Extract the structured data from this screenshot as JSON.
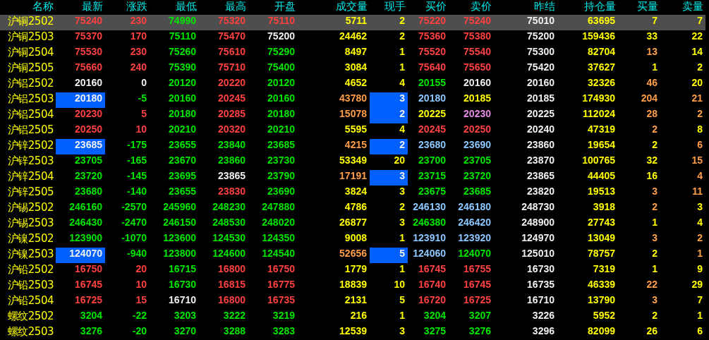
{
  "columns": [
    "名称",
    "最新",
    "涨跌",
    "最低",
    "最高",
    "开盘",
    "成交量",
    "现手",
    "买价",
    "卖价",
    "昨结",
    "持仓量",
    "买量",
    "卖量"
  ],
  "rows": [
    {
      "name": "沪铜2502",
      "selected": true,
      "cells": [
        {
          "text": "75240",
          "color": "#ff4040",
          "flash": false
        },
        {
          "text": "230",
          "color": "#ff4040",
          "flash": false
        },
        {
          "text": "74990",
          "color": "#00e600",
          "flash": false
        },
        {
          "text": "75320",
          "color": "#ff4040",
          "flash": false
        },
        {
          "text": "75110",
          "color": "#ff4040",
          "flash": false
        },
        {
          "text": "5711",
          "color": "#ffff00",
          "flash": false
        },
        {
          "text": "2",
          "color": "#ffff00",
          "flash": false
        },
        {
          "text": "75220",
          "color": "#ff4040",
          "flash": false
        },
        {
          "text": "75240",
          "color": "#ff4040",
          "flash": false
        },
        {
          "text": "75010",
          "color": "#f0f0f0",
          "flash": false
        },
        {
          "text": "63695",
          "color": "#ffff00",
          "flash": false
        },
        {
          "text": "7",
          "color": "#ffff00",
          "flash": false
        },
        {
          "text": "7",
          "color": "#ffff00",
          "flash": false
        }
      ]
    },
    {
      "name": "沪铜2503",
      "selected": false,
      "cells": [
        {
          "text": "75370",
          "color": "#ff4040",
          "flash": false
        },
        {
          "text": "170",
          "color": "#ff4040",
          "flash": false
        },
        {
          "text": "75110",
          "color": "#00e600",
          "flash": false
        },
        {
          "text": "75470",
          "color": "#ff4040",
          "flash": false
        },
        {
          "text": "75200",
          "color": "#f0f0f0",
          "flash": false
        },
        {
          "text": "24462",
          "color": "#ffff00",
          "flash": false
        },
        {
          "text": "2",
          "color": "#ffff00",
          "flash": false
        },
        {
          "text": "75360",
          "color": "#ff4040",
          "flash": false
        },
        {
          "text": "75380",
          "color": "#ff4040",
          "flash": false
        },
        {
          "text": "75200",
          "color": "#f0f0f0",
          "flash": false
        },
        {
          "text": "159436",
          "color": "#ffff00",
          "flash": false
        },
        {
          "text": "33",
          "color": "#ffff00",
          "flash": false
        },
        {
          "text": "22",
          "color": "#ffff00",
          "flash": false
        }
      ]
    },
    {
      "name": "沪铜2504",
      "selected": false,
      "cells": [
        {
          "text": "75530",
          "color": "#ff4040",
          "flash": false
        },
        {
          "text": "230",
          "color": "#ff4040",
          "flash": false
        },
        {
          "text": "75260",
          "color": "#00e600",
          "flash": false
        },
        {
          "text": "75610",
          "color": "#ff4040",
          "flash": false
        },
        {
          "text": "75290",
          "color": "#00e600",
          "flash": false
        },
        {
          "text": "8497",
          "color": "#ffff00",
          "flash": false
        },
        {
          "text": "1",
          "color": "#ffff00",
          "flash": false
        },
        {
          "text": "75520",
          "color": "#ff4040",
          "flash": false
        },
        {
          "text": "75540",
          "color": "#ff4040",
          "flash": false
        },
        {
          "text": "75300",
          "color": "#f0f0f0",
          "flash": false
        },
        {
          "text": "82704",
          "color": "#ffff00",
          "flash": false
        },
        {
          "text": "13",
          "color": "#ff9e4a",
          "flash": false
        },
        {
          "text": "14",
          "color": "#ffff00",
          "flash": false
        }
      ]
    },
    {
      "name": "沪铜2505",
      "selected": false,
      "cells": [
        {
          "text": "75660",
          "color": "#ff4040",
          "flash": false
        },
        {
          "text": "240",
          "color": "#ff4040",
          "flash": false
        },
        {
          "text": "75390",
          "color": "#00e600",
          "flash": false
        },
        {
          "text": "75710",
          "color": "#ff4040",
          "flash": false
        },
        {
          "text": "75400",
          "color": "#00e600",
          "flash": false
        },
        {
          "text": "3084",
          "color": "#ffff00",
          "flash": false
        },
        {
          "text": "1",
          "color": "#ffff00",
          "flash": false
        },
        {
          "text": "75640",
          "color": "#ff4040",
          "flash": false
        },
        {
          "text": "75650",
          "color": "#ff4040",
          "flash": false
        },
        {
          "text": "75420",
          "color": "#f0f0f0",
          "flash": false
        },
        {
          "text": "37627",
          "color": "#ffff00",
          "flash": false
        },
        {
          "text": "1",
          "color": "#ffff00",
          "flash": false
        },
        {
          "text": "2",
          "color": "#ffff00",
          "flash": false
        }
      ]
    },
    {
      "name": "沪铝2502",
      "selected": false,
      "cells": [
        {
          "text": "20160",
          "color": "#f0f0f0",
          "flash": false
        },
        {
          "text": "0",
          "color": "#f0f0f0",
          "flash": false
        },
        {
          "text": "20120",
          "color": "#00e600",
          "flash": false
        },
        {
          "text": "20220",
          "color": "#ff4040",
          "flash": false
        },
        {
          "text": "20120",
          "color": "#00e600",
          "flash": false
        },
        {
          "text": "4652",
          "color": "#ffff00",
          "flash": false
        },
        {
          "text": "4",
          "color": "#ffff00",
          "flash": false
        },
        {
          "text": "20155",
          "color": "#00e600",
          "flash": false
        },
        {
          "text": "20160",
          "color": "#f0f0f0",
          "flash": false
        },
        {
          "text": "20160",
          "color": "#f0f0f0",
          "flash": false
        },
        {
          "text": "32326",
          "color": "#ffff00",
          "flash": false
        },
        {
          "text": "46",
          "color": "#ff9e4a",
          "flash": false
        },
        {
          "text": "20",
          "color": "#ffff00",
          "flash": false
        }
      ]
    },
    {
      "name": "沪铝2503",
      "selected": false,
      "cells": [
        {
          "text": "20180",
          "color": "#f0f0f0",
          "flash": true
        },
        {
          "text": "-5",
          "color": "#00e600",
          "flash": false
        },
        {
          "text": "20160",
          "color": "#00e600",
          "flash": false
        },
        {
          "text": "20245",
          "color": "#ff4040",
          "flash": false
        },
        {
          "text": "20160",
          "color": "#00e600",
          "flash": false
        },
        {
          "text": "43780",
          "color": "#ff9e4a",
          "flash": false
        },
        {
          "text": "3",
          "color": "#f0f0f0",
          "flash": true
        },
        {
          "text": "20180",
          "color": "#8cc8ff",
          "flash": false
        },
        {
          "text": "20185",
          "color": "#ffff00",
          "flash": false
        },
        {
          "text": "20185",
          "color": "#f0f0f0",
          "flash": false
        },
        {
          "text": "174930",
          "color": "#ffff00",
          "flash": false
        },
        {
          "text": "204",
          "color": "#ff9e4a",
          "flash": false
        },
        {
          "text": "21",
          "color": "#ff9e4a",
          "flash": false
        }
      ]
    },
    {
      "name": "沪铝2504",
      "selected": false,
      "cells": [
        {
          "text": "20230",
          "color": "#ff4040",
          "flash": false
        },
        {
          "text": "5",
          "color": "#ff4040",
          "flash": false
        },
        {
          "text": "20180",
          "color": "#00e600",
          "flash": false
        },
        {
          "text": "20285",
          "color": "#ff4040",
          "flash": false
        },
        {
          "text": "20180",
          "color": "#00e600",
          "flash": false
        },
        {
          "text": "15078",
          "color": "#ff9e4a",
          "flash": false
        },
        {
          "text": "2",
          "color": "#f0f0f0",
          "flash": true
        },
        {
          "text": "20225",
          "color": "#ffff00",
          "flash": false
        },
        {
          "text": "20230",
          "color": "#e68ce6",
          "flash": false
        },
        {
          "text": "20225",
          "color": "#f0f0f0",
          "flash": false
        },
        {
          "text": "112024",
          "color": "#ffff00",
          "flash": false
        },
        {
          "text": "28",
          "color": "#ff9e4a",
          "flash": false
        },
        {
          "text": "2",
          "color": "#ff9e4a",
          "flash": false
        }
      ]
    },
    {
      "name": "沪铝2505",
      "selected": false,
      "cells": [
        {
          "text": "20250",
          "color": "#ff4040",
          "flash": false
        },
        {
          "text": "10",
          "color": "#ff4040",
          "flash": false
        },
        {
          "text": "20210",
          "color": "#00e600",
          "flash": false
        },
        {
          "text": "20320",
          "color": "#ff4040",
          "flash": false
        },
        {
          "text": "20210",
          "color": "#00e600",
          "flash": false
        },
        {
          "text": "5595",
          "color": "#ffff00",
          "flash": false
        },
        {
          "text": "4",
          "color": "#ffff00",
          "flash": false
        },
        {
          "text": "20245",
          "color": "#ff4040",
          "flash": false
        },
        {
          "text": "20250",
          "color": "#ff4040",
          "flash": false
        },
        {
          "text": "20240",
          "color": "#f0f0f0",
          "flash": false
        },
        {
          "text": "47319",
          "color": "#ffff00",
          "flash": false
        },
        {
          "text": "2",
          "color": "#ff9e4a",
          "flash": false
        },
        {
          "text": "8",
          "color": "#ffff00",
          "flash": false
        }
      ]
    },
    {
      "name": "沪锌2502",
      "selected": false,
      "cells": [
        {
          "text": "23685",
          "color": "#f0f0f0",
          "flash": true
        },
        {
          "text": "-175",
          "color": "#00e600",
          "flash": false
        },
        {
          "text": "23655",
          "color": "#00e600",
          "flash": false
        },
        {
          "text": "23840",
          "color": "#00e600",
          "flash": false
        },
        {
          "text": "23685",
          "color": "#00e600",
          "flash": false
        },
        {
          "text": "4215",
          "color": "#ff9e4a",
          "flash": false
        },
        {
          "text": "2",
          "color": "#f0f0f0",
          "flash": true
        },
        {
          "text": "23680",
          "color": "#8cc8ff",
          "flash": false
        },
        {
          "text": "23690",
          "color": "#8cc8ff",
          "flash": false
        },
        {
          "text": "23860",
          "color": "#f0f0f0",
          "flash": false
        },
        {
          "text": "19654",
          "color": "#ffff00",
          "flash": false
        },
        {
          "text": "2",
          "color": "#ffff00",
          "flash": false
        },
        {
          "text": "6",
          "color": "#ff9e4a",
          "flash": false
        }
      ]
    },
    {
      "name": "沪锌2503",
      "selected": false,
      "cells": [
        {
          "text": "23705",
          "color": "#00e600",
          "flash": false
        },
        {
          "text": "-165",
          "color": "#00e600",
          "flash": false
        },
        {
          "text": "23670",
          "color": "#00e600",
          "flash": false
        },
        {
          "text": "23860",
          "color": "#00e600",
          "flash": false
        },
        {
          "text": "23730",
          "color": "#00e600",
          "flash": false
        },
        {
          "text": "53349",
          "color": "#ffff00",
          "flash": false
        },
        {
          "text": "20",
          "color": "#ffff00",
          "flash": false
        },
        {
          "text": "23700",
          "color": "#00e600",
          "flash": false
        },
        {
          "text": "23705",
          "color": "#00e600",
          "flash": false
        },
        {
          "text": "23870",
          "color": "#f0f0f0",
          "flash": false
        },
        {
          "text": "100765",
          "color": "#ffff00",
          "flash": false
        },
        {
          "text": "32",
          "color": "#ffff00",
          "flash": false
        },
        {
          "text": "15",
          "color": "#ff9e4a",
          "flash": false
        }
      ]
    },
    {
      "name": "沪锌2504",
      "selected": false,
      "cells": [
        {
          "text": "23720",
          "color": "#00e600",
          "flash": false
        },
        {
          "text": "-145",
          "color": "#00e600",
          "flash": false
        },
        {
          "text": "23695",
          "color": "#00e600",
          "flash": false
        },
        {
          "text": "23865",
          "color": "#f0f0f0",
          "flash": false
        },
        {
          "text": "23790",
          "color": "#00e600",
          "flash": false
        },
        {
          "text": "17191",
          "color": "#ff9e4a",
          "flash": false
        },
        {
          "text": "3",
          "color": "#f0f0f0",
          "flash": true
        },
        {
          "text": "23715",
          "color": "#00e600",
          "flash": false
        },
        {
          "text": "23720",
          "color": "#00e600",
          "flash": false
        },
        {
          "text": "23865",
          "color": "#f0f0f0",
          "flash": false
        },
        {
          "text": "44405",
          "color": "#ffff00",
          "flash": false
        },
        {
          "text": "16",
          "color": "#ffff00",
          "flash": false
        },
        {
          "text": "4",
          "color": "#ff9e4a",
          "flash": false
        }
      ]
    },
    {
      "name": "沪锌2505",
      "selected": false,
      "cells": [
        {
          "text": "23680",
          "color": "#00e600",
          "flash": false
        },
        {
          "text": "-140",
          "color": "#00e600",
          "flash": false
        },
        {
          "text": "23655",
          "color": "#00e600",
          "flash": false
        },
        {
          "text": "23830",
          "color": "#ff4040",
          "flash": false
        },
        {
          "text": "23690",
          "color": "#00e600",
          "flash": false
        },
        {
          "text": "3824",
          "color": "#ffff00",
          "flash": false
        },
        {
          "text": "3",
          "color": "#ffff00",
          "flash": false
        },
        {
          "text": "23675",
          "color": "#00e600",
          "flash": false
        },
        {
          "text": "23685",
          "color": "#00e600",
          "flash": false
        },
        {
          "text": "23820",
          "color": "#f0f0f0",
          "flash": false
        },
        {
          "text": "19513",
          "color": "#ffff00",
          "flash": false
        },
        {
          "text": "3",
          "color": "#ff9e4a",
          "flash": false
        },
        {
          "text": "11",
          "color": "#ff9e4a",
          "flash": false
        }
      ]
    },
    {
      "name": "沪锡2502",
      "selected": false,
      "cells": [
        {
          "text": "246160",
          "color": "#00e600",
          "flash": false
        },
        {
          "text": "-2570",
          "color": "#00e600",
          "flash": false
        },
        {
          "text": "245960",
          "color": "#00e600",
          "flash": false
        },
        {
          "text": "248230",
          "color": "#00e600",
          "flash": false
        },
        {
          "text": "247880",
          "color": "#00e600",
          "flash": false
        },
        {
          "text": "4786",
          "color": "#ffff00",
          "flash": false
        },
        {
          "text": "2",
          "color": "#ffff00",
          "flash": false
        },
        {
          "text": "246130",
          "color": "#8cc8ff",
          "flash": false
        },
        {
          "text": "246180",
          "color": "#8cc8ff",
          "flash": false
        },
        {
          "text": "248730",
          "color": "#f0f0f0",
          "flash": false
        },
        {
          "text": "3918",
          "color": "#ffff00",
          "flash": false
        },
        {
          "text": "2",
          "color": "#ff9e4a",
          "flash": false
        },
        {
          "text": "3",
          "color": "#ffff00",
          "flash": false
        }
      ]
    },
    {
      "name": "沪锡2503",
      "selected": false,
      "cells": [
        {
          "text": "246430",
          "color": "#00e600",
          "flash": false
        },
        {
          "text": "-2470",
          "color": "#00e600",
          "flash": false
        },
        {
          "text": "246150",
          "color": "#00e600",
          "flash": false
        },
        {
          "text": "248530",
          "color": "#00e600",
          "flash": false
        },
        {
          "text": "248020",
          "color": "#00e600",
          "flash": false
        },
        {
          "text": "26877",
          "color": "#ffff00",
          "flash": false
        },
        {
          "text": "3",
          "color": "#ffff00",
          "flash": false
        },
        {
          "text": "246380",
          "color": "#00e600",
          "flash": false
        },
        {
          "text": "246420",
          "color": "#8cc8ff",
          "flash": false
        },
        {
          "text": "248900",
          "color": "#f0f0f0",
          "flash": false
        },
        {
          "text": "27743",
          "color": "#ffff00",
          "flash": false
        },
        {
          "text": "1",
          "color": "#ffff00",
          "flash": false
        },
        {
          "text": "4",
          "color": "#ffff00",
          "flash": false
        }
      ]
    },
    {
      "name": "沪镍2502",
      "selected": false,
      "cells": [
        {
          "text": "123900",
          "color": "#00e600",
          "flash": false
        },
        {
          "text": "-1070",
          "color": "#00e600",
          "flash": false
        },
        {
          "text": "123600",
          "color": "#00e600",
          "flash": false
        },
        {
          "text": "124530",
          "color": "#00e600",
          "flash": false
        },
        {
          "text": "124350",
          "color": "#00e600",
          "flash": false
        },
        {
          "text": "9008",
          "color": "#ffff00",
          "flash": false
        },
        {
          "text": "1",
          "color": "#ffff00",
          "flash": false
        },
        {
          "text": "123910",
          "color": "#8cc8ff",
          "flash": false
        },
        {
          "text": "123920",
          "color": "#8cc8ff",
          "flash": false
        },
        {
          "text": "124970",
          "color": "#f0f0f0",
          "flash": false
        },
        {
          "text": "13049",
          "color": "#ffff00",
          "flash": false
        },
        {
          "text": "3",
          "color": "#ff9e4a",
          "flash": false
        },
        {
          "text": "2",
          "color": "#ff9e4a",
          "flash": false
        }
      ]
    },
    {
      "name": "沪镍2503",
      "selected": false,
      "cells": [
        {
          "text": "124070",
          "color": "#f0f0f0",
          "flash": true
        },
        {
          "text": "-940",
          "color": "#00e600",
          "flash": false
        },
        {
          "text": "123800",
          "color": "#00e600",
          "flash": false
        },
        {
          "text": "124600",
          "color": "#00e600",
          "flash": false
        },
        {
          "text": "124540",
          "color": "#00e600",
          "flash": false
        },
        {
          "text": "52656",
          "color": "#ff9e4a",
          "flash": false
        },
        {
          "text": "5",
          "color": "#f0f0f0",
          "flash": true
        },
        {
          "text": "124060",
          "color": "#8cc8ff",
          "flash": false
        },
        {
          "text": "124070",
          "color": "#00e600",
          "flash": false
        },
        {
          "text": "125010",
          "color": "#f0f0f0",
          "flash": false
        },
        {
          "text": "78757",
          "color": "#ffff00",
          "flash": false
        },
        {
          "text": "2",
          "color": "#ffff00",
          "flash": false
        },
        {
          "text": "1",
          "color": "#ff9e4a",
          "flash": false
        }
      ]
    },
    {
      "name": "沪铅2502",
      "selected": false,
      "cells": [
        {
          "text": "16750",
          "color": "#ff4040",
          "flash": false
        },
        {
          "text": "20",
          "color": "#ff4040",
          "flash": false
        },
        {
          "text": "16715",
          "color": "#00e600",
          "flash": false
        },
        {
          "text": "16800",
          "color": "#ff4040",
          "flash": false
        },
        {
          "text": "16750",
          "color": "#ff4040",
          "flash": false
        },
        {
          "text": "1779",
          "color": "#ffff00",
          "flash": false
        },
        {
          "text": "1",
          "color": "#ffff00",
          "flash": false
        },
        {
          "text": "16745",
          "color": "#ff4040",
          "flash": false
        },
        {
          "text": "16755",
          "color": "#ff4040",
          "flash": false
        },
        {
          "text": "16730",
          "color": "#f0f0f0",
          "flash": false
        },
        {
          "text": "7319",
          "color": "#ffff00",
          "flash": false
        },
        {
          "text": "1",
          "color": "#ffff00",
          "flash": false
        },
        {
          "text": "9",
          "color": "#ffff00",
          "flash": false
        }
      ]
    },
    {
      "name": "沪铅2503",
      "selected": false,
      "cells": [
        {
          "text": "16745",
          "color": "#ff4040",
          "flash": false
        },
        {
          "text": "10",
          "color": "#ff4040",
          "flash": false
        },
        {
          "text": "16730",
          "color": "#00e600",
          "flash": false
        },
        {
          "text": "16815",
          "color": "#ff4040",
          "flash": false
        },
        {
          "text": "16775",
          "color": "#ff4040",
          "flash": false
        },
        {
          "text": "18839",
          "color": "#ffff00",
          "flash": false
        },
        {
          "text": "10",
          "color": "#ffff00",
          "flash": false
        },
        {
          "text": "16740",
          "color": "#ff4040",
          "flash": false
        },
        {
          "text": "16745",
          "color": "#ff4040",
          "flash": false
        },
        {
          "text": "16735",
          "color": "#f0f0f0",
          "flash": false
        },
        {
          "text": "46339",
          "color": "#ffff00",
          "flash": false
        },
        {
          "text": "22",
          "color": "#ff9e4a",
          "flash": false
        },
        {
          "text": "29",
          "color": "#ffff00",
          "flash": false
        }
      ]
    },
    {
      "name": "沪铅2504",
      "selected": false,
      "cells": [
        {
          "text": "16725",
          "color": "#ff4040",
          "flash": false
        },
        {
          "text": "15",
          "color": "#ff4040",
          "flash": false
        },
        {
          "text": "16710",
          "color": "#f0f0f0",
          "flash": false
        },
        {
          "text": "16800",
          "color": "#ff4040",
          "flash": false
        },
        {
          "text": "16735",
          "color": "#ff4040",
          "flash": false
        },
        {
          "text": "2131",
          "color": "#ffff00",
          "flash": false
        },
        {
          "text": "5",
          "color": "#ffff00",
          "flash": false
        },
        {
          "text": "16720",
          "color": "#ff4040",
          "flash": false
        },
        {
          "text": "16725",
          "color": "#ff4040",
          "flash": false
        },
        {
          "text": "16710",
          "color": "#f0f0f0",
          "flash": false
        },
        {
          "text": "13790",
          "color": "#ffff00",
          "flash": false
        },
        {
          "text": "3",
          "color": "#ff9e4a",
          "flash": false
        },
        {
          "text": "7",
          "color": "#ffff00",
          "flash": false
        }
      ]
    },
    {
      "name": "螺纹2502",
      "selected": false,
      "cells": [
        {
          "text": "3204",
          "color": "#00e600",
          "flash": false
        },
        {
          "text": "-22",
          "color": "#00e600",
          "flash": false
        },
        {
          "text": "3203",
          "color": "#00e600",
          "flash": false
        },
        {
          "text": "3222",
          "color": "#00e600",
          "flash": false
        },
        {
          "text": "3219",
          "color": "#00e600",
          "flash": false
        },
        {
          "text": "216",
          "color": "#ffff00",
          "flash": false
        },
        {
          "text": "1",
          "color": "#ffff00",
          "flash": false
        },
        {
          "text": "3204",
          "color": "#00e600",
          "flash": false
        },
        {
          "text": "3207",
          "color": "#00e600",
          "flash": false
        },
        {
          "text": "3226",
          "color": "#f0f0f0",
          "flash": false
        },
        {
          "text": "5952",
          "color": "#ffff00",
          "flash": false
        },
        {
          "text": "2",
          "color": "#ffff00",
          "flash": false
        },
        {
          "text": "1",
          "color": "#ffff00",
          "flash": false
        }
      ]
    },
    {
      "name": "螺纹2503",
      "selected": false,
      "cells": [
        {
          "text": "3276",
          "color": "#00e600",
          "flash": false
        },
        {
          "text": "-20",
          "color": "#00e600",
          "flash": false
        },
        {
          "text": "3270",
          "color": "#00e600",
          "flash": false
        },
        {
          "text": "3288",
          "color": "#00e600",
          "flash": false
        },
        {
          "text": "3283",
          "color": "#00e600",
          "flash": false
        },
        {
          "text": "12539",
          "color": "#ffff00",
          "flash": false
        },
        {
          "text": "3",
          "color": "#ffff00",
          "flash": false
        },
        {
          "text": "3275",
          "color": "#00e600",
          "flash": false
        },
        {
          "text": "3276",
          "color": "#00e600",
          "flash": false
        },
        {
          "text": "3296",
          "color": "#f0f0f0",
          "flash": false
        },
        {
          "text": "82099",
          "color": "#ffff00",
          "flash": false
        },
        {
          "text": "26",
          "color": "#ffff00",
          "flash": false
        },
        {
          "text": "6",
          "color": "#ffff00",
          "flash": false
        }
      ]
    }
  ]
}
